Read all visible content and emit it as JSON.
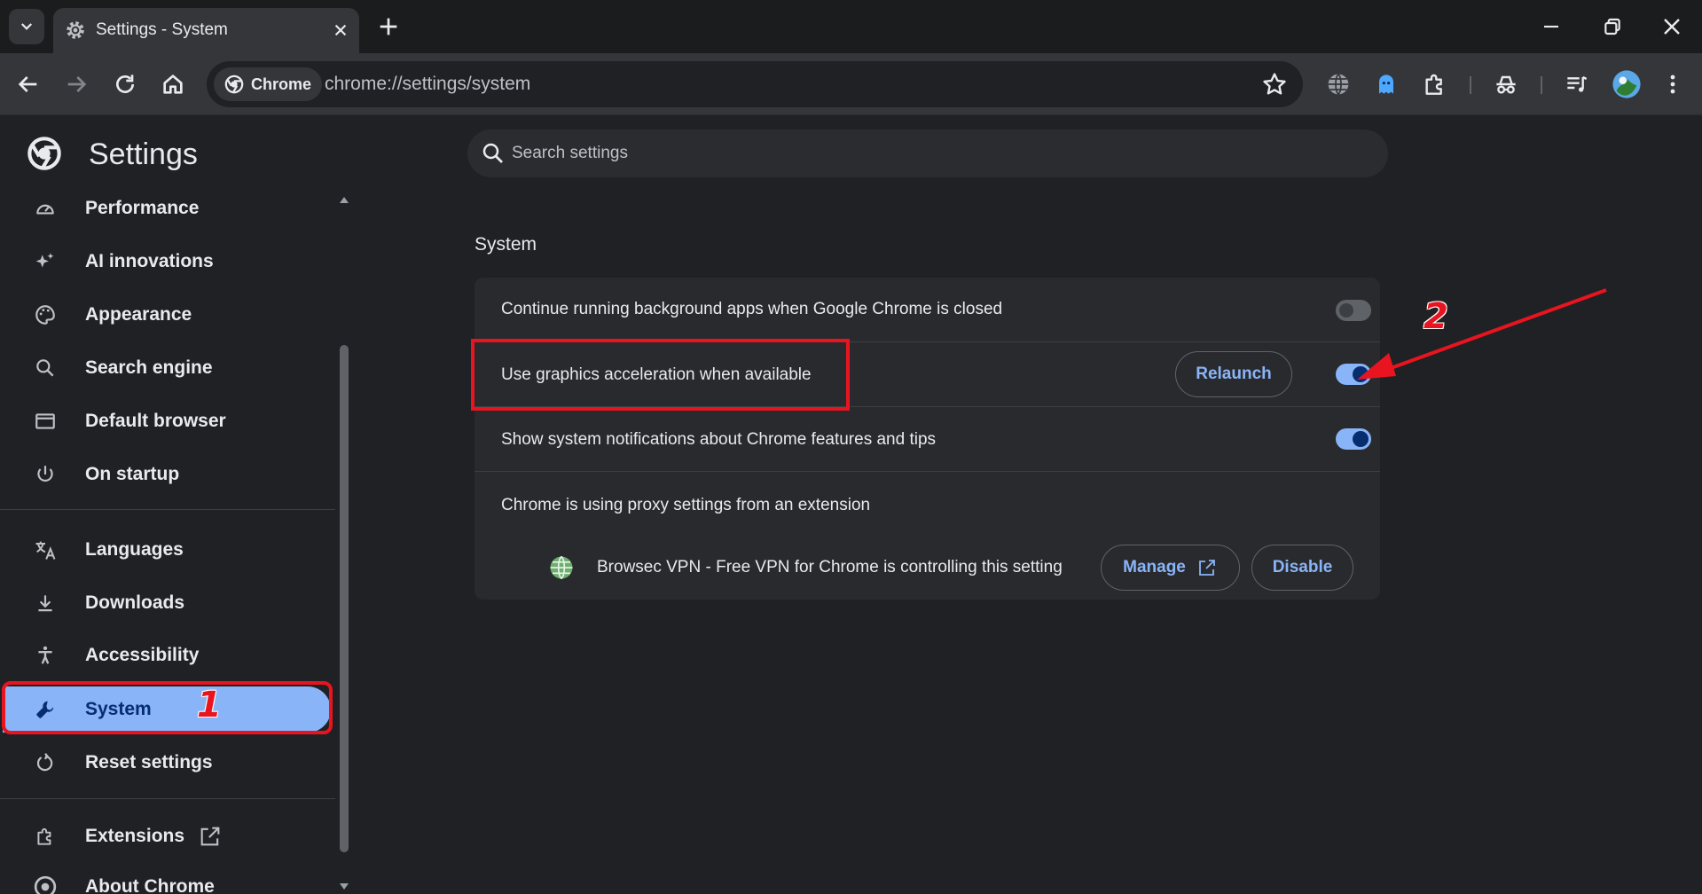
{
  "browser": {
    "tab_title": "Settings - System",
    "omnibox_chip": "Chrome",
    "url": "chrome://settings/system"
  },
  "sidebar": {
    "title": "Settings",
    "items": [
      {
        "label": "Performance",
        "icon": "speedometer-icon"
      },
      {
        "label": "AI innovations",
        "icon": "sparkle-icon"
      },
      {
        "label": "Appearance",
        "icon": "palette-icon"
      },
      {
        "label": "Search engine",
        "icon": "search-icon"
      },
      {
        "label": "Default browser",
        "icon": "browser-window-icon"
      },
      {
        "label": "On startup",
        "icon": "power-icon"
      },
      {
        "label": "Languages",
        "icon": "translate-icon"
      },
      {
        "label": "Downloads",
        "icon": "download-icon"
      },
      {
        "label": "Accessibility",
        "icon": "accessibility-icon"
      },
      {
        "label": "System",
        "icon": "wrench-icon",
        "active": true
      },
      {
        "label": "Reset settings",
        "icon": "reset-icon"
      },
      {
        "label": "Extensions",
        "icon": "puzzle-icon"
      },
      {
        "label": "About Chrome",
        "icon": "chrome-icon"
      }
    ]
  },
  "search": {
    "placeholder": "Search settings"
  },
  "system": {
    "section_title": "System",
    "rows": [
      {
        "label": "Continue running background apps when Google Chrome is closed",
        "toggle": "off"
      },
      {
        "label": "Use graphics acceleration when available",
        "toggle": "on",
        "button": "Relaunch"
      },
      {
        "label": "Show system notifications about Chrome features and tips",
        "toggle": "on"
      }
    ],
    "proxy": {
      "label": "Chrome is using proxy settings from an extension",
      "extension_text": "Browsec VPN - Free VPN for Chrome is controlling this setting",
      "manage_label": "Manage",
      "disable_label": "Disable"
    }
  },
  "annotations": {
    "step1": "1",
    "step2": "2"
  },
  "colors": {
    "accent": "#8ab4f8",
    "annotation": "#e8141f",
    "background": "#202124"
  }
}
